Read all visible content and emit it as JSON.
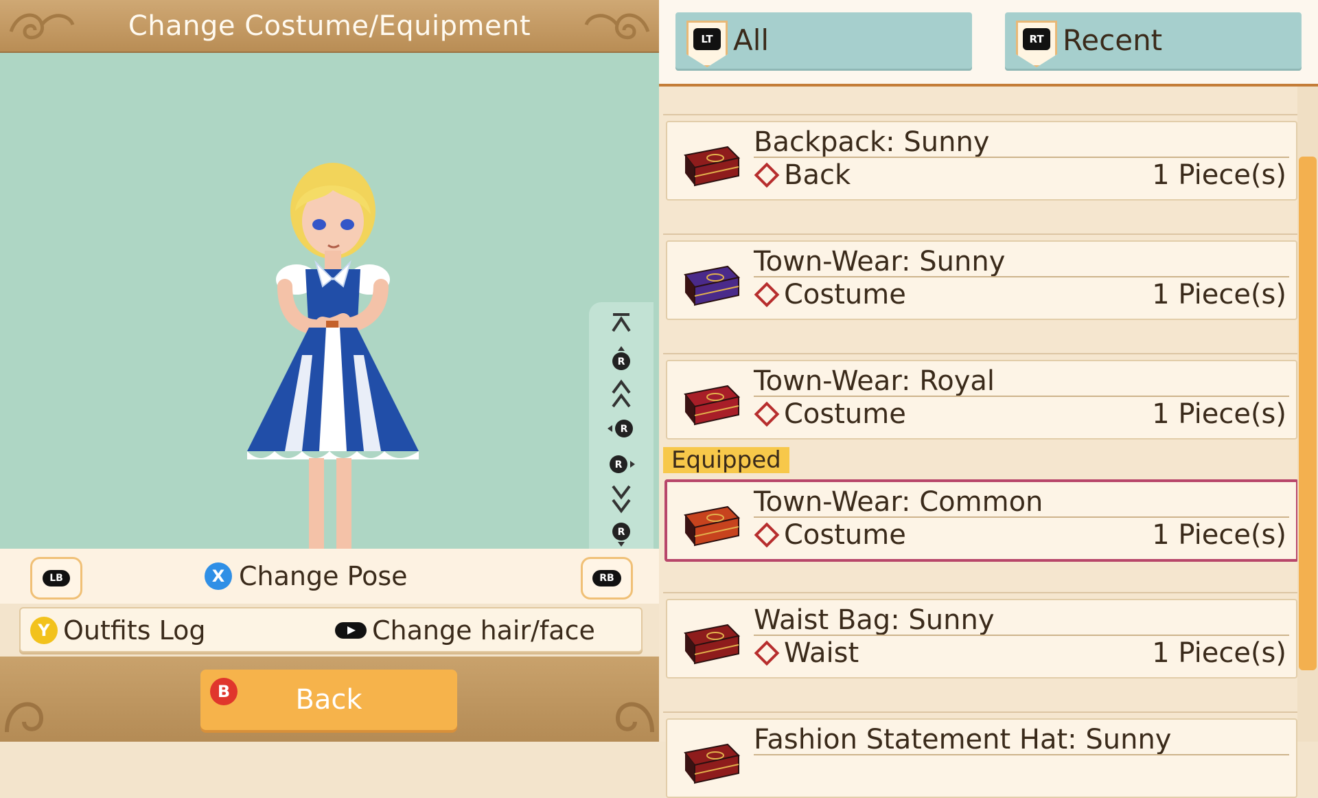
{
  "header": {
    "title": "Change Costume/Equipment"
  },
  "pose_bar": {
    "lb": "LB",
    "rb": "RB",
    "x_glyph": "X",
    "change_pose": "Change Pose"
  },
  "info_bar": {
    "y_glyph": "Y",
    "outfits_log": "Outfits Log",
    "change_hair_face": "Change hair/face"
  },
  "back": {
    "glyph": "B",
    "label": "Back"
  },
  "tabs": [
    {
      "glyph": "LT",
      "label": "All"
    },
    {
      "glyph": "RT",
      "label": "Recent"
    }
  ],
  "equipped_label": "Equipped",
  "items": [
    {
      "name": "Backpack: Sunny",
      "category": "Back",
      "qty": "1 Piece(s)",
      "icon": "backpack-icon",
      "color": "#8e1c1c"
    },
    {
      "name": "Town-Wear: Sunny",
      "category": "Costume",
      "qty": "1 Piece(s)",
      "icon": "purple-chest-icon",
      "color": "#4a2a8a"
    },
    {
      "name": "Town-Wear: Royal",
      "category": "Costume",
      "qty": "1 Piece(s)",
      "icon": "red-chest-icon",
      "color": "#a81e28"
    },
    {
      "name": "Town-Wear: Common",
      "category": "Costume",
      "qty": "1 Piece(s)",
      "icon": "orange-chest-icon",
      "color": "#c7431e",
      "equipped": true
    },
    {
      "name": "Waist Bag: Sunny",
      "category": "Waist",
      "qty": "1 Piece(s)",
      "icon": "waist-bag-icon",
      "color": "#8e1c1c"
    },
    {
      "name": "Fashion Statement Hat: Sunny",
      "category": "",
      "qty": "",
      "icon": "hat-icon",
      "color": "#8e1c1c"
    }
  ],
  "colors": {
    "accent": "#f6b34b",
    "equipped_border": "#b8466a",
    "viewport_bg": "#aed6c4",
    "tab_bg": "#a6cfcd"
  }
}
